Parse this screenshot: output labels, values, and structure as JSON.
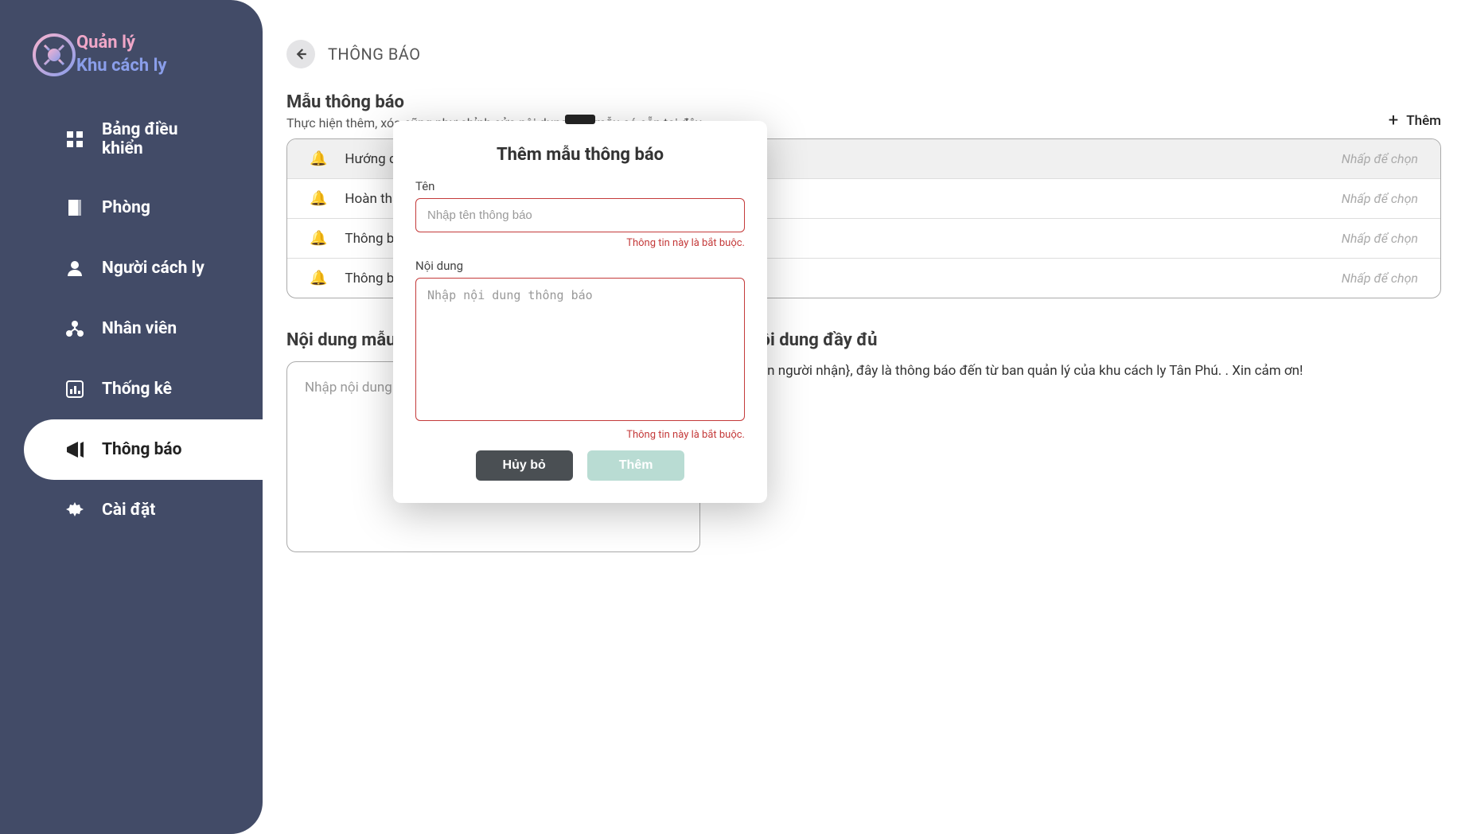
{
  "brand": {
    "line1": "Quản lý",
    "line2": "Khu cách ly"
  },
  "sidebar": {
    "items": [
      {
        "label": "Bảng điều khiển",
        "key": "dashboard"
      },
      {
        "label": "Phòng",
        "key": "rooms"
      },
      {
        "label": "Người cách ly",
        "key": "quarantined"
      },
      {
        "label": "Nhân viên",
        "key": "staff"
      },
      {
        "label": "Thống kê",
        "key": "stats"
      },
      {
        "label": "Thông báo",
        "key": "notifications"
      },
      {
        "label": "Cài đặt",
        "key": "settings"
      }
    ],
    "active_index": 5
  },
  "page": {
    "title": "THÔNG BÁO",
    "section_title": "Mẫu thông báo",
    "section_sub": "Thực hiện thêm, xóa cũng như chỉnh sửa nội dung của mẫu có sẵn tại đây.",
    "add_label": "Thêm",
    "list_hint": "Nhấp để chọn",
    "items": [
      {
        "label": "Hướng dẫn",
        "selected": true
      },
      {
        "label": "Hoàn thành",
        "selected": false
      },
      {
        "label": "Thông báo",
        "selected": false
      },
      {
        "label": "Thông báo",
        "selected": false
      }
    ],
    "preview_title": "Nội dung mẫu",
    "preview_placeholder": "Nhập nội dung",
    "full_title": "Nội dung đầy đủ",
    "full_text": "{Tên người nhận}, đây là thông báo đến từ ban quản lý của khu cách ly Tân Phú. . Xin cảm ơn!"
  },
  "modal": {
    "title": "Thêm mẫu thông báo",
    "name_label": "Tên",
    "name_placeholder": "Nhập tên thông báo",
    "content_label": "Nội dung",
    "content_placeholder": "Nhập nội dung thông báo",
    "error": "Thông tin này là bắt buộc.",
    "cancel": "Hủy bỏ",
    "submit": "Thêm"
  }
}
